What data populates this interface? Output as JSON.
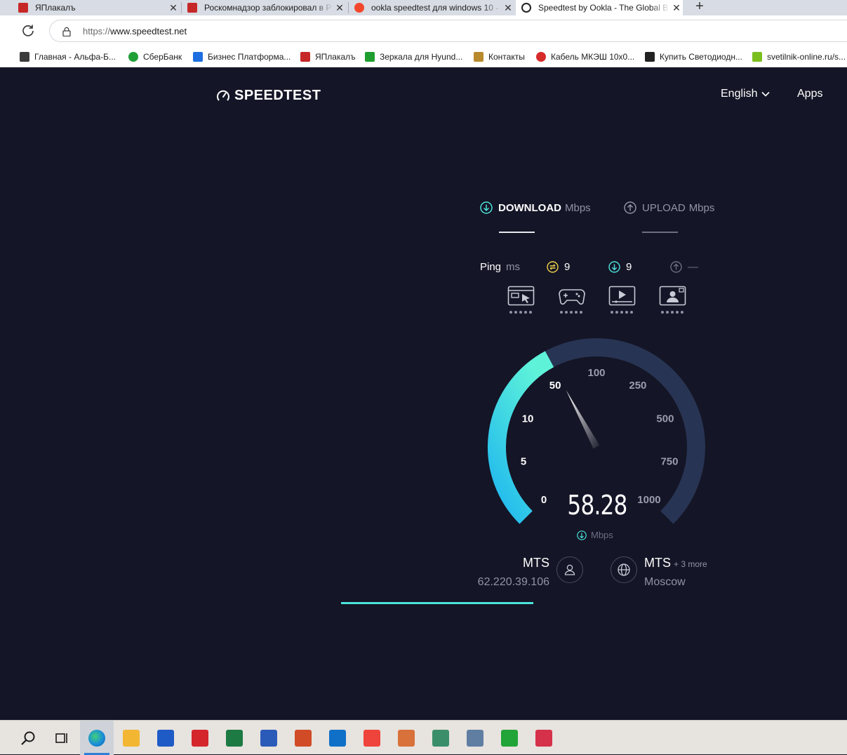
{
  "browser": {
    "tabs": [
      {
        "title": "ЯПлакалъ",
        "active": false
      },
      {
        "title": "Роскомнадзор заблокировал в Р",
        "active": false
      },
      {
        "title": "ookla speedtest для windows 10 -",
        "active": false
      },
      {
        "title": "Speedtest by Ookla - The Global B",
        "active": true
      }
    ],
    "close_glyph": "✕",
    "newtab_glyph": "+",
    "url_protocol": "https://",
    "url_host": "www.speedtest.net",
    "bookmarks": [
      {
        "label": "Главная - Альфа-Б...",
        "color": "#3b3b3b"
      },
      {
        "label": "СберБанк",
        "color": "#21a038"
      },
      {
        "label": "Бизнес Платформа...",
        "color": "#1d6fe0"
      },
      {
        "label": "ЯПлакалъ",
        "color": "#c62828"
      },
      {
        "label": "Зеркала для Hyund...",
        "color": "#1e9e2e"
      },
      {
        "label": "Контакты",
        "color": "#b98a2c"
      },
      {
        "label": "Кабель МКЭШ 10х0...",
        "color": "#d62b2b"
      },
      {
        "label": "Купить Светодиодн...",
        "color": "#222222"
      },
      {
        "label": "svetilnik-online.ru/s...",
        "color": "#7bbf1e"
      }
    ]
  },
  "header": {
    "logo_text": "SPEEDTEST",
    "language": "English",
    "apps": "Apps"
  },
  "metrics": {
    "download_label": "DOWNLOAD",
    "download_unit": "Mbps",
    "upload_label": "UPLOAD",
    "upload_unit": "Mbps"
  },
  "ping": {
    "label": "Ping",
    "unit": "ms",
    "idle": "9",
    "download": "9",
    "upload": "—"
  },
  "gauge": {
    "value": "58.28",
    "unit": "Mbps",
    "value_numeric": 58.28,
    "ticks": [
      "0",
      "5",
      "10",
      "50",
      "100",
      "250",
      "500",
      "750",
      "1000"
    ],
    "accent_start": "#1eb6ef",
    "accent_end": "#5ef3d9",
    "track_color": "#283453"
  },
  "isp": {
    "name": "MTS",
    "ip": "62.220.39.106"
  },
  "server": {
    "name": "MTS",
    "more": "+ 3 more",
    "city": "Moscow"
  },
  "progress_fraction": 1.0,
  "colors": {
    "background": "#141526",
    "accent": "#4ce3db",
    "muted": "#9193a8"
  },
  "taskbar": [
    {
      "name": "search-taskbar-icon",
      "color": "#1b1b1b"
    },
    {
      "name": "task-view-taskbar-icon",
      "color": "#1b1b1b"
    },
    {
      "name": "edge-taskbar-icon",
      "color": "#1a8fd8"
    },
    {
      "name": "file-explorer-taskbar-icon",
      "color": "#f2b632"
    },
    {
      "name": "app-blue-grid-taskbar-icon",
      "color": "#1e5bc6"
    },
    {
      "name": "app-swirl-taskbar-icon",
      "color": "#d4262b"
    },
    {
      "name": "excel-taskbar-icon",
      "color": "#1d7a43"
    },
    {
      "name": "word-taskbar-icon",
      "color": "#2b5bb9"
    },
    {
      "name": "powerpoint-taskbar-icon",
      "color": "#d04b26"
    },
    {
      "name": "outlook-taskbar-icon",
      "color": "#1070c8"
    },
    {
      "name": "anydesk-taskbar-icon",
      "color": "#ef443b"
    },
    {
      "name": "app-pencil-taskbar-icon",
      "color": "#d9713a"
    },
    {
      "name": "app-diagram-taskbar-icon",
      "color": "#3a8f6a"
    },
    {
      "name": "calculator-taskbar-icon",
      "color": "#5f7ea2"
    },
    {
      "name": "app-green-taskbar-icon",
      "color": "#21a438"
    },
    {
      "name": "app-camera-taskbar-icon",
      "color": "#d6314a"
    }
  ]
}
